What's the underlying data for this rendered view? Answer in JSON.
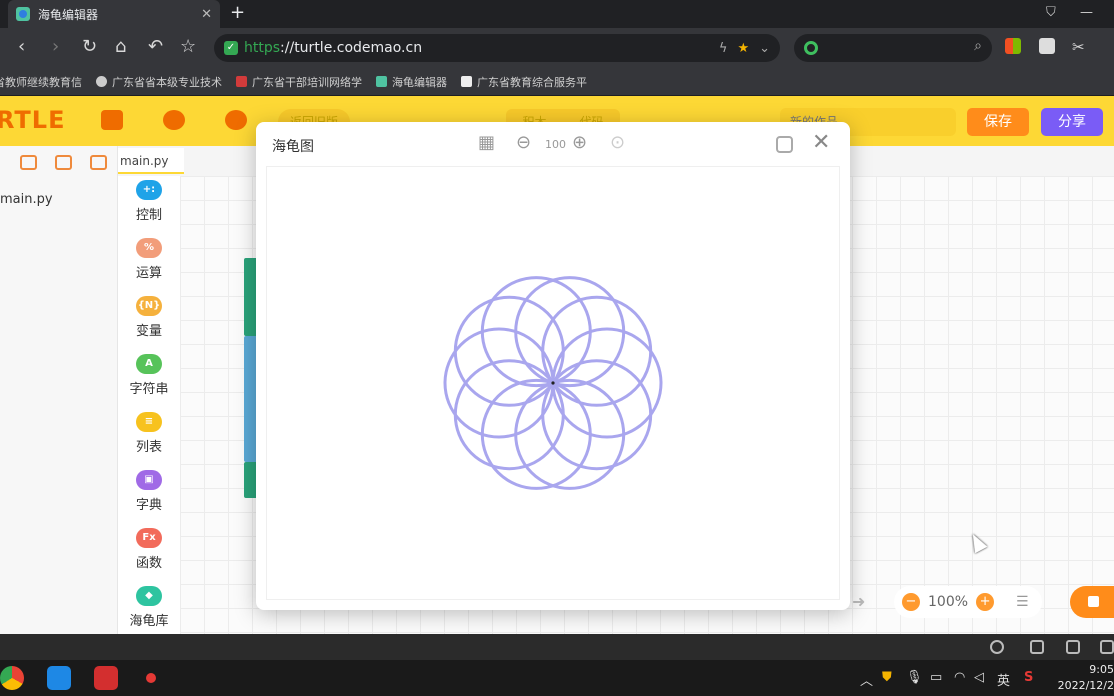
{
  "browser": {
    "tab_title": "海龟编辑器",
    "tab_close": "✕",
    "new_tab": "+",
    "url_scheme": "https",
    "url_rest": "://turtle.codemao.cn",
    "bookmarks": [
      "省教师继续教育信",
      "广东省省本级专业技术",
      "广东省干部培训网络学",
      "海龟编辑器",
      "广东省教育综合服务平"
    ]
  },
  "app": {
    "logo": "RTLE",
    "back_label": "返回旧版",
    "segments": [
      "积木",
      "代码"
    ],
    "name_placeholder": "新的作品",
    "save_label": "保存",
    "share_label": "分享",
    "file_name": "main.py",
    "tab_name": "main.py",
    "categories": [
      {
        "label": "控制",
        "badge": "+:",
        "color": "#1fa3e8"
      },
      {
        "label": "运算",
        "badge": "%",
        "color": "#f29d7a"
      },
      {
        "label": "变量",
        "badge": "{N}",
        "color": "#f5b13d"
      },
      {
        "label": "字符串",
        "badge": "A",
        "color": "#57c35a"
      },
      {
        "label": "列表",
        "badge": "≡",
        "color": "#f7c21e"
      },
      {
        "label": "字典",
        "badge": "▣",
        "color": "#a06ae6"
      },
      {
        "label": "函数",
        "badge": "Fx",
        "color": "#f26b5b"
      },
      {
        "label": "海龟库",
        "badge": "◆",
        "color": "#2ec4a0"
      }
    ],
    "zoom_label": "100%",
    "zoom_minus": "−",
    "zoom_plus": "+"
  },
  "dialog": {
    "title": "海龟图",
    "zoom_value": "100",
    "close": "✕",
    "drawing": {
      "petals": 10,
      "color": "#a9a6ee"
    }
  },
  "taskbar": {
    "time": "9:05",
    "date": "2022/12/2",
    "ime": "英"
  }
}
